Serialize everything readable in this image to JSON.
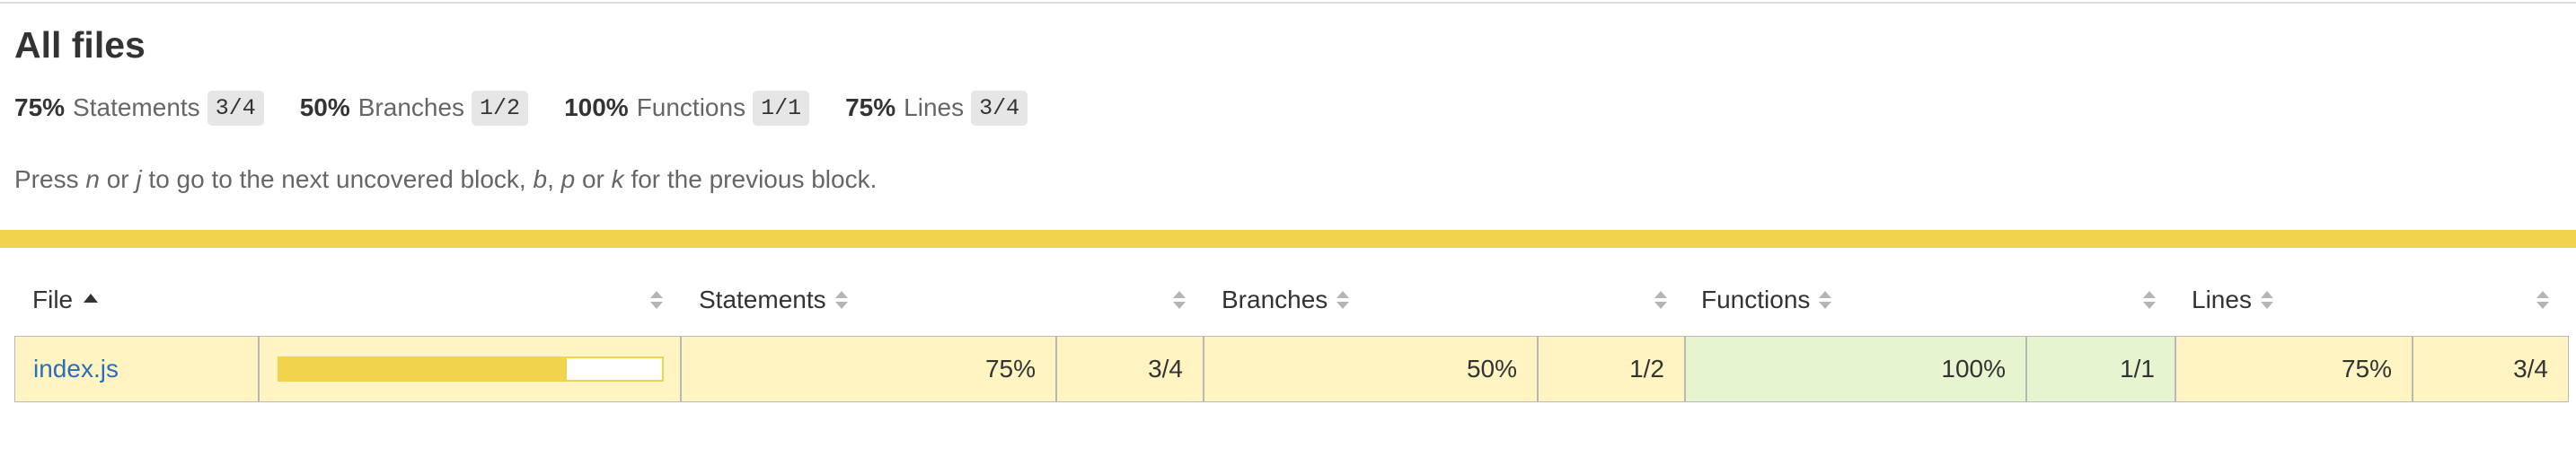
{
  "page": {
    "title": "All files",
    "summary": [
      {
        "pct": "75%",
        "label": "Statements",
        "fraction": "3/4"
      },
      {
        "pct": "50%",
        "label": "Branches",
        "fraction": "1/2"
      },
      {
        "pct": "100%",
        "label": "Functions",
        "fraction": "1/1"
      },
      {
        "pct": "75%",
        "label": "Lines",
        "fraction": "3/4"
      }
    ],
    "hint": {
      "p1": "Press ",
      "k1": "n",
      "p2": " or ",
      "k2": "j",
      "p3": " to go to the next uncovered block, ",
      "k3": "b",
      "p4": ", ",
      "k4": "p",
      "p5": " or ",
      "k5": "k",
      "p6": " for the previous block."
    },
    "status_color": "#f2d34c"
  },
  "table": {
    "headers": {
      "file": "File",
      "statements": "Statements",
      "branches": "Branches",
      "functions": "Functions",
      "lines": "Lines"
    },
    "sort": {
      "column": "File",
      "direction": "ascending"
    },
    "rows": [
      {
        "file": "index.js",
        "coverage_fraction": 0.75,
        "statements_pct": "75%",
        "statements_frac": "3/4",
        "branches_pct": "50%",
        "branches_frac": "1/2",
        "functions_pct": "100%",
        "functions_frac": "1/1",
        "lines_pct": "75%",
        "lines_frac": "3/4"
      }
    ]
  },
  "colors": {
    "medium_bg": "#fff4c2",
    "high_bg": "#e6f5d0",
    "link": "#2a6fbb"
  },
  "icons": [
    "sort-ascending-icon",
    "sort-both-icon"
  ]
}
